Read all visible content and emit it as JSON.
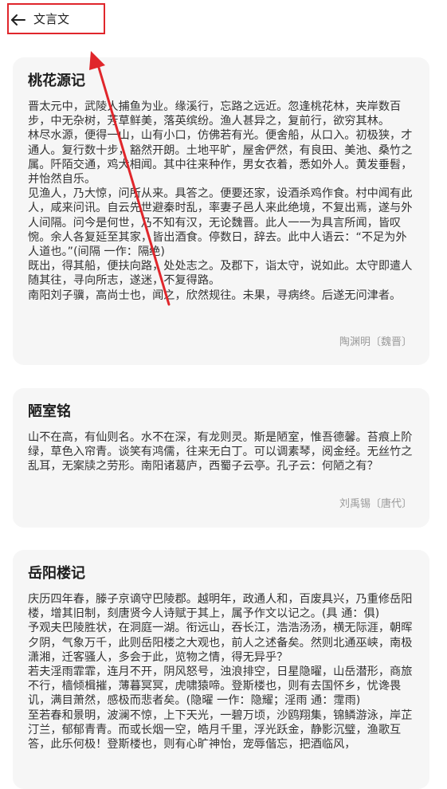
{
  "header": {
    "title": "文言文",
    "back_icon": "arrow-left-icon"
  },
  "annotation_color": "#e0262b",
  "cards": [
    {
      "title": "桃花源记",
      "paragraphs": [
        "晋太元中，武陵人捕鱼为业。缘溪行，忘路之远近。忽逢桃花林，夹岸数百步，中无杂树，芳草鲜美，落英缤纷。渔人甚异之，复前行，欲穷其林。",
        "林尽水源，便得一山，山有小口，仿佛若有光。便舍船，从口入。初极狭，才通人。复行数十步，豁然开朗。土地平旷，屋舍俨然，有良田、美池、桑竹之属。阡陌交通，鸡犬相闻。其中往来种作，男女衣着，悉如外人。黄发垂髫，并怡然自乐。",
        "见渔人，乃大惊，问所从来。具答之。便要还家，设酒杀鸡作食。村中闻有此人，咸来问讯。自云先世避秦时乱，率妻子邑人来此绝境，不复出焉，遂与外人间隔。问今是何世，乃不知有汉，无论魏晋。此人一一为具言所闻，皆叹惋。余人各复延至其家，皆出酒食。停数日，辞去。此中人语云：“不足为外人道也。”(间隔 一作：隔绝)",
        "既出，得其船，便扶向路，处处志之。及郡下，诣太守，说如此。太守即遣人随其往，寻向所志，遂迷，不复得路。",
        "南阳刘子骥，高尚士也，闻之，欣然规往。未果，寻病终。后遂无问津者。"
      ],
      "author": "陶渊明〔魏晋〕"
    },
    {
      "title": "陋室铭",
      "paragraphs": [
        "山不在高，有仙则名。水不在深，有龙则灵。斯是陋室，惟吾德馨。苔痕上阶绿，草色入帘青。谈笑有鸿儒，往来无白丁。可以调素琴，阅金经。无丝竹之乱耳，无案牍之劳形。南阳诸葛庐，西蜀子云亭。孔子云：何陋之有？"
      ],
      "author": "刘禹锡〔唐代〕"
    },
    {
      "title": "岳阳楼记",
      "paragraphs": [
        "庆历四年春，滕子京谪守巴陵郡。越明年，政通人和，百废具兴，乃重修岳阳楼，增其旧制，刻唐贤今人诗赋于其上，属予作文以记之。(具 通：俱)",
        "予观夫巴陵胜状，在洞庭一湖。衔远山，吞长江，浩浩汤汤，横无际涯，朝晖夕阴，气象万千，此则岳阳楼之大观也，前人之述备矣。然则北通巫峡，南极潇湘，迁客骚人，多会于此，览物之情，得无异乎？",
        "若夫淫雨霏霏，连月不开，阴风怒号，浊浪排空，日星隐曜，山岳潜形，商旅不行，樯倾楫摧，薄暮冥冥，虎啸猿啼。登斯楼也，则有去国怀乡，忧谗畏讥，满目萧然，感极而悲者矣。(隐曜 一作：隐耀；淫雨 通：霪雨)",
        "至若春和景明，波澜不惊，上下天光，一碧万顷，沙鸥翔集，锦鳞游泳，岸芷汀兰，郁郁青青。而或长烟一空，皓月千里，浮光跃金，静影沉璧，渔歌互答，此乐何极！登斯楼也，则有心旷神怡，宠辱偕忘，把酒临风，"
      ],
      "author": ""
    }
  ]
}
